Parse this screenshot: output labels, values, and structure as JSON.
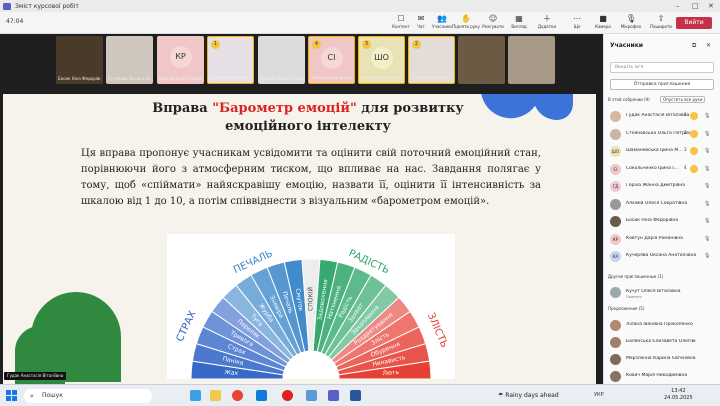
{
  "window": {
    "title": "Зміст курсової робіт"
  },
  "toolbar": {
    "timer": "47:04",
    "buttons": [
      {
        "label": "Контент",
        "icon": "chat-bubble-icon",
        "glyph": "☐"
      },
      {
        "label": "Чат",
        "icon": "chat-icon",
        "glyph": "✉"
      },
      {
        "label": "Учасники",
        "icon": "people-icon",
        "glyph": "👥"
      },
      {
        "label": "Підняти руку",
        "icon": "raise-hand-icon",
        "glyph": "✋"
      },
      {
        "label": "Реагувати",
        "icon": "smile-icon",
        "glyph": "☺"
      },
      {
        "label": "Вигляд",
        "icon": "view-icon",
        "glyph": "▦"
      },
      {
        "label": "Додатки",
        "icon": "apps-icon",
        "glyph": "＋"
      },
      {
        "label": "Ще",
        "icon": "more-icon",
        "glyph": "⋯"
      },
      {
        "label": "Камера",
        "icon": "camera-icon",
        "glyph": "■"
      },
      {
        "label": "Мікрофон",
        "icon": "microphone-icon",
        "glyph": "🎙"
      },
      {
        "label": "Поширити",
        "icon": "share-icon",
        "glyph": "⇧"
      }
    ],
    "leave_label": "Вийти"
  },
  "tiles": [
    {
      "name": "Босик Ніна Федорівна",
      "initials": "",
      "hand": "",
      "bg": "#4a3a2a"
    },
    {
      "name": "Кучерява Оксана Анатоліївна",
      "initials": "",
      "hand": "",
      "bg": "#cfc6bd"
    },
    {
      "name": "Ковтун Дарія Романівна",
      "initials": "КР",
      "hand": "",
      "bg": "#f0c6c6"
    },
    {
      "name": "Гудак Анастасія Віталіївна",
      "initials": "",
      "hand": "1",
      "bg": "#e6e0e6"
    },
    {
      "name": "Алхімій Олеся Сократівна",
      "initials": "",
      "hand": "",
      "bg": "#dcdcdc"
    },
    {
      "name": "Сокольченко Ірина Ігорівна",
      "initials": "СІ",
      "hand": "4",
      "bg": "#f0c6c6"
    },
    {
      "name": "Шаманевська Ірина Миколаївна",
      "initials": "ШО",
      "hand": "3",
      "bg": "#e8e2b6"
    },
    {
      "name": "Стояновська Ольга Петрівна",
      "initials": "",
      "hand": "2",
      "bg": "#e4dcd6"
    },
    {
      "name": "",
      "initials": "",
      "hand": "",
      "bg": "#6b5a44"
    },
    {
      "name": "",
      "initials": "",
      "hand": "",
      "bg": "#a89a88"
    }
  ],
  "slide": {
    "title_part1": "Вправа ",
    "title_highlight": "\"Барометр емоцій\"",
    "title_part2": " для розвитку емоційного інтелекту",
    "body": "Ця вправа пропонує учасникам усвідомити та оцінити свій поточний емоційний стан, порівнюючи його з атмосферним тиском, що впливає на нас. Завдання полягає у тому, щоб «спіймати» найяскравішу емоцію, назвати її, оцінити її інтенсивність за шкалою від 1 до 10, а потім співвіднести з візуальним «барометром емоцій».",
    "wheel": {
      "center": "СПОКІЙ",
      "groups": [
        "СТРАХ",
        "ПЕЧАЛЬ",
        "РАДІСТЬ",
        "ЗЛІСТЬ"
      ],
      "left_sectors": [
        "Жах",
        "Паніка",
        "Страх",
        "Тривога",
        "Переляк",
        "Туга",
        "Журба",
        "Зневіра",
        "Печаль",
        "Смуток"
      ],
      "right_sectors": [
        "Задоволення",
        "Натхнення",
        "Радість",
        "Захват",
        "Захоплення",
        "Роздратування",
        "Злість",
        "Обурення",
        "Ненависть",
        "Лють"
      ],
      "colors": {
        "fear": "#2e63c6",
        "sad": "#3a86c8",
        "calm": "#ededed",
        "joy": "#2fa66a",
        "anger": "#e5392f"
      }
    }
  },
  "presenter_label": "Гудак Анастасія Віталіївна",
  "panel": {
    "title": "Учасники",
    "search_placeholder": "Введіть ім'я",
    "invite_label": "Отправка приглашения",
    "section_meeting": "В этой собрании (9)",
    "lower_all_label": "Опустить все руки",
    "participants": [
      {
        "name": "Гудак Анастасія Віталіївна",
        "initials": "",
        "hand": "1",
        "av": "#d8b7a0"
      },
      {
        "name": "Стояновська Ольга Петрівна",
        "initials": "",
        "hand": "2",
        "av": "#c9b4a8"
      },
      {
        "name": "Шаманевська Ірина М...",
        "initials": "ШО",
        "hand": "3",
        "av": "#e8e2b6"
      },
      {
        "name": "Сокольченко Ірина І...",
        "initials": "СІ",
        "hand": "4",
        "av": "#f0c6c6"
      },
      {
        "name": "Горіха Жанна Дмитрівна",
        "initials": "ГД",
        "hand": "",
        "av": "#f1c9d6"
      },
      {
        "name": "Алхімій Олеся Сократівна",
        "initials": "",
        "hand": "",
        "av": "#999"
      },
      {
        "name": "Босик Ніна Федорівна",
        "initials": "",
        "hand": "",
        "av": "#6a5a4a"
      },
      {
        "name": "Ковтун Дарія Романівна",
        "initials": "КР",
        "hand": "",
        "av": "#f0c6c6"
      },
      {
        "name": "Кучерява Оксана Анатоліївна",
        "initials": "КА",
        "hand": "",
        "av": "#c6d4f0"
      }
    ],
    "section_others": "Другие приглашенные (1)",
    "others": [
      {
        "name": "Кучут Олеся Віталіївна",
        "sub": "Принято",
        "av": "#9aa"
      }
    ],
    "section_suggested": "Предложения (5)",
    "suggested": [
      {
        "name": "Лілана Іванівна Прокопенко",
        "av": "#b08a70"
      },
      {
        "name": "Балянська Єлизавета Олегівна",
        "av": "#a07f6b"
      },
      {
        "name": "Мерзлікіна Карина Євгенівна",
        "av": "#7d6a5a"
      },
      {
        "name": "Ковач Марія Никодимівна",
        "av": "#8a7060"
      }
    ]
  },
  "taskbar": {
    "search": "Пошук",
    "weather": "Rainy days ahead",
    "tray": "УКР",
    "time": "13:42",
    "date": "24.05.2025"
  }
}
